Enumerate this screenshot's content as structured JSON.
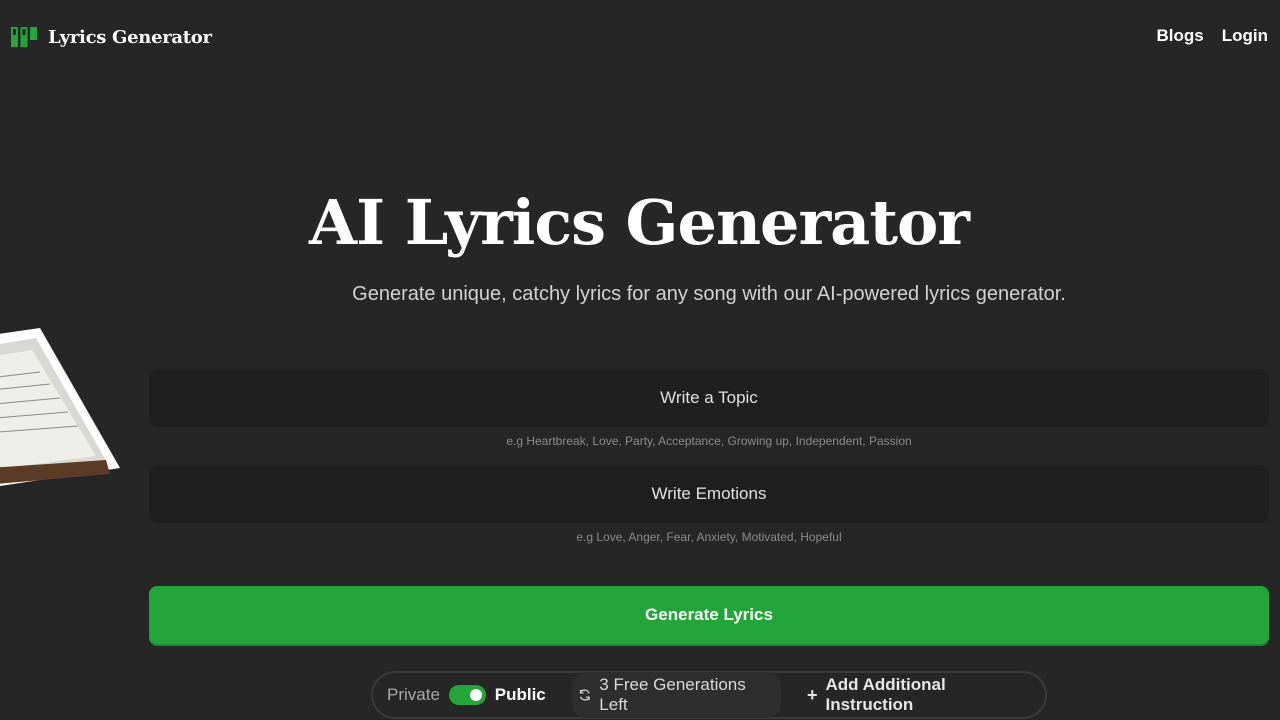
{
  "header": {
    "brand": "Lyrics Generator",
    "nav": [
      {
        "label": "Blogs"
      },
      {
        "label": "Login"
      }
    ]
  },
  "hero": {
    "title": "AI Lyrics Generator",
    "subtitle": "Generate unique, catchy lyrics for any song with our AI-powered lyrics generator."
  },
  "form": {
    "topic": {
      "placeholder": "Write a Topic",
      "value": "",
      "hint": "e.g Heartbreak, Love, Party, Acceptance, Growing up, Independent, Passion"
    },
    "emotions": {
      "placeholder": "Write Emotions",
      "value": "",
      "hint": "e.g Love, Anger, Fear, Anxiety, Motivated, Hopeful"
    },
    "generate_label": "Generate Lyrics"
  },
  "options": {
    "private_label": "Private",
    "public_label": "Public",
    "visibility": "public",
    "generations_left": "3 Free Generations Left",
    "add_instruction": "Add Additional Instruction"
  },
  "colors": {
    "background": "#262626",
    "input_bg": "#1f1f1f",
    "accent": "#22a63a",
    "text": "#ffffff"
  },
  "icons": {
    "logo": "lyrics-logo-icon",
    "refresh": "refresh-icon",
    "plus": "plus-icon",
    "decor": "notebook-illustration"
  }
}
